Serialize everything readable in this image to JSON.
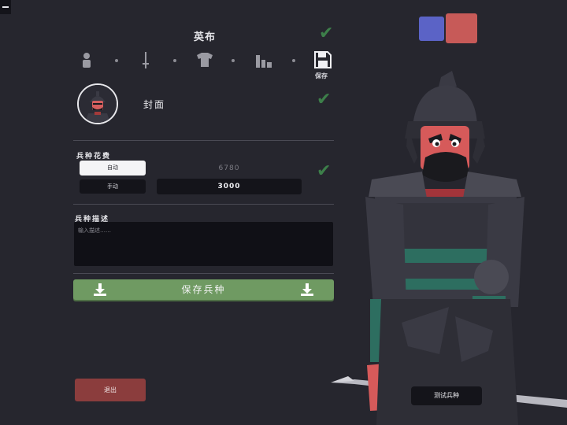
{
  "unit_name": "英布",
  "cover_label": "封面",
  "steps": {
    "save_label": "保存"
  },
  "cost": {
    "section_label": "兵种花费",
    "auto_label": "自动",
    "manual_label": "手动",
    "auto_value": "6780",
    "manual_value": "3000"
  },
  "description": {
    "section_label": "兵种描述",
    "placeholder": "输入描述……"
  },
  "save_unit_label": "保存兵种",
  "exit_label": "退出",
  "test_unit_label": "测试兵种",
  "colors": {
    "team_blue": "#5b63c6",
    "team_red": "#c75a58",
    "confirm_green": "#3d7f4a",
    "save_button": "#6f9a62",
    "exit_button": "#8b3d3d"
  }
}
